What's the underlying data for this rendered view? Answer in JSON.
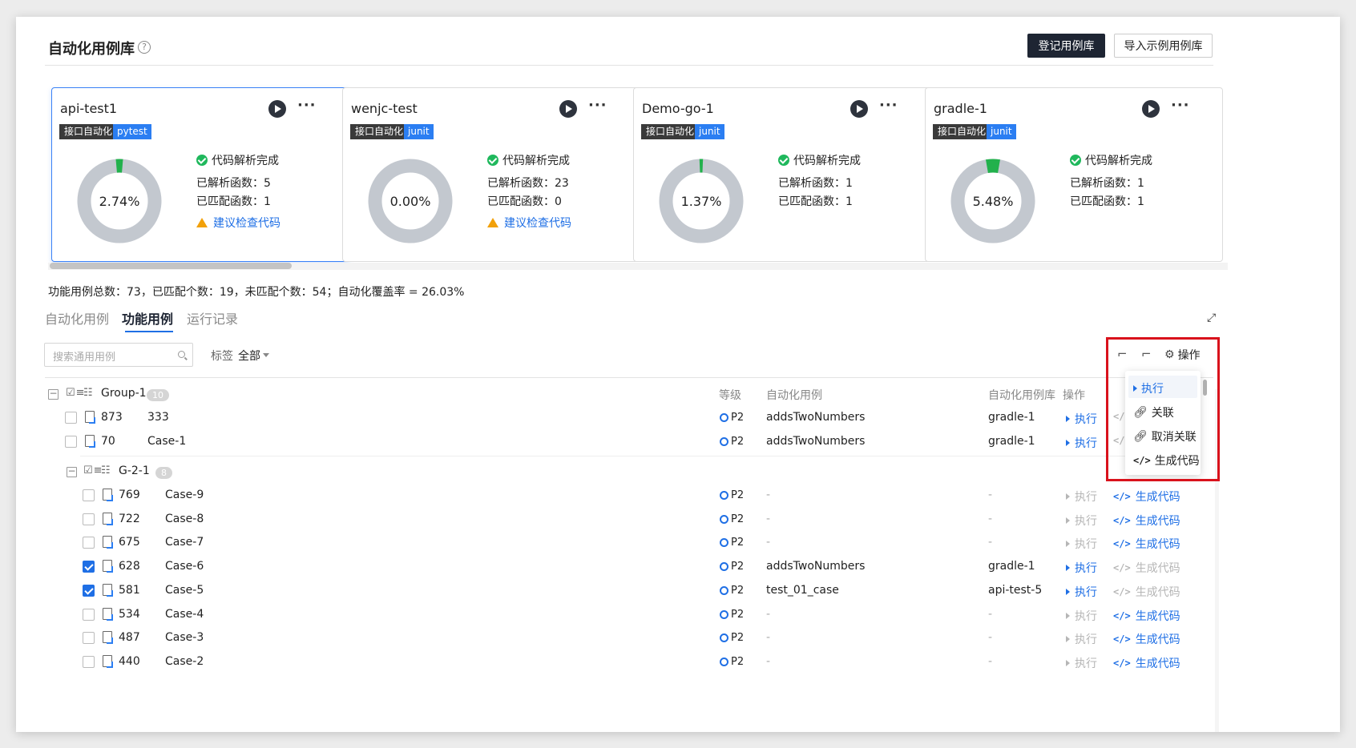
{
  "header": {
    "title": "自动化用例库",
    "help_icon": "?",
    "register_button": "登记用例库",
    "import_button": "导入示例用例库"
  },
  "cards": [
    {
      "name": "api-test1",
      "tag_type": "接口自动化",
      "tag_framework": "pytest",
      "percent": "2.74%",
      "percent_value": 2.74,
      "status": "代码解析完成",
      "parsed": "已解析函数：5",
      "matched": "已匹配函数：1",
      "warning": "建议检查代码"
    },
    {
      "name": "wenjc-test",
      "tag_type": "接口自动化",
      "tag_framework": "junit",
      "percent": "0.00%",
      "percent_value": 0.0,
      "status": "代码解析完成",
      "parsed": "已解析函数：23",
      "matched": "已匹配函数：0",
      "warning": "建议检查代码"
    },
    {
      "name": "Demo-go-1",
      "tag_type": "接口自动化",
      "tag_framework": "junit",
      "percent": "1.37%",
      "percent_value": 1.37,
      "status": "代码解析完成",
      "parsed": "已解析函数：1",
      "matched": "已匹配函数：1",
      "warning": ""
    },
    {
      "name": "gradle-1",
      "tag_type": "接口自动化",
      "tag_framework": "junit",
      "percent": "5.48%",
      "percent_value": 5.48,
      "status": "代码解析完成",
      "parsed": "已解析函数：1",
      "matched": "已匹配函数：1",
      "warning": ""
    }
  ],
  "colors": {
    "donut_fill": "#22b14c",
    "donut_bg": "#c3c8cf",
    "accent": "#1f6fe5",
    "highlight_border": "#d9121c"
  },
  "summary": "功能用例总数：73，已匹配个数：19，未匹配个数：54；自动化覆盖率 = 26.03%",
  "tabs": [
    "自动化用例",
    "功能用例",
    "运行记录"
  ],
  "active_tab": 1,
  "search": {
    "placeholder": "搜索通用用例"
  },
  "filter": {
    "label": "标签",
    "value": "全部"
  },
  "toolbar": {
    "operate_label": "操作"
  },
  "dropdown": [
    "执行",
    "关联",
    "取消关联",
    "生成代码"
  ],
  "table": {
    "headers": {
      "level": "等级",
      "auto_case": "自动化用例",
      "auto_lib": "自动化用例库",
      "ops": "操作"
    },
    "group1": {
      "name": "Group-1",
      "count": "10"
    },
    "group1_rows": [
      {
        "id": "873",
        "name": "333",
        "prio": "P2",
        "auto_case": "addsTwoNumbers",
        "lib": "gradle-1",
        "execute": "执行",
        "checked": false
      },
      {
        "id": "70",
        "name": "Case-1",
        "prio": "P2",
        "auto_case": "addsTwoNumbers",
        "lib": "gradle-1",
        "execute": "执行",
        "checked": false
      }
    ],
    "group2": {
      "name": "G-2-1",
      "count": "8"
    },
    "group2_rows": [
      {
        "id": "769",
        "name": "Case-9",
        "prio": "P2",
        "auto_case": "-",
        "lib": "-",
        "execute": "执行",
        "gen": "生成代码",
        "checked": false,
        "linked": false
      },
      {
        "id": "722",
        "name": "Case-8",
        "prio": "P2",
        "auto_case": "-",
        "lib": "-",
        "execute": "执行",
        "gen": "生成代码",
        "checked": false,
        "linked": false
      },
      {
        "id": "675",
        "name": "Case-7",
        "prio": "P2",
        "auto_case": "-",
        "lib": "-",
        "execute": "执行",
        "gen": "生成代码",
        "checked": false,
        "linked": false
      },
      {
        "id": "628",
        "name": "Case-6",
        "prio": "P2",
        "auto_case": "addsTwoNumbers",
        "lib": "gradle-1",
        "execute": "执行",
        "gen": "生成代码",
        "checked": true,
        "linked": true
      },
      {
        "id": "581",
        "name": "Case-5",
        "prio": "P2",
        "auto_case": "test_01_case",
        "lib": "api-test-5",
        "execute": "执行",
        "gen": "生成代码",
        "checked": true,
        "linked": true
      },
      {
        "id": "534",
        "name": "Case-4",
        "prio": "P2",
        "auto_case": "-",
        "lib": "-",
        "execute": "执行",
        "gen": "生成代码",
        "checked": false,
        "linked": false
      },
      {
        "id": "487",
        "name": "Case-3",
        "prio": "P2",
        "auto_case": "-",
        "lib": "-",
        "execute": "执行",
        "gen": "生成代码",
        "checked": false,
        "linked": false
      },
      {
        "id": "440",
        "name": "Case-2",
        "prio": "P2",
        "auto_case": "-",
        "lib": "-",
        "execute": "执行",
        "gen": "生成代码",
        "checked": false,
        "linked": false
      }
    ]
  }
}
